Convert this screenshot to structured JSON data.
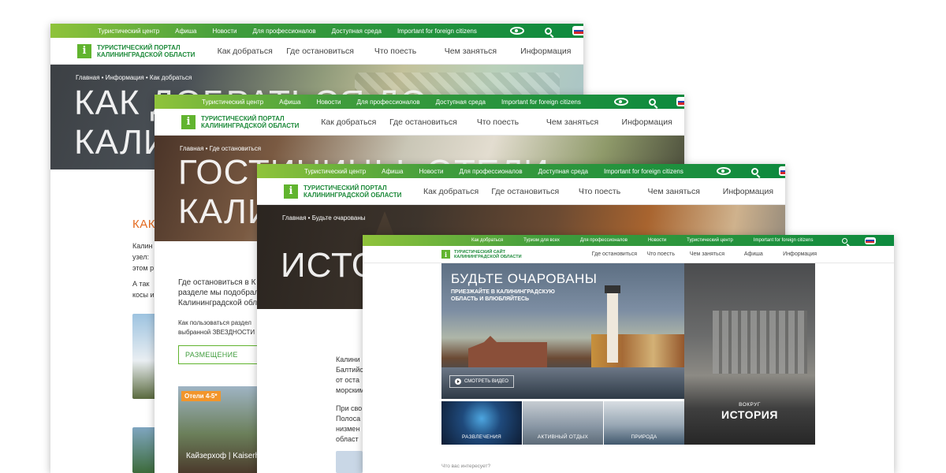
{
  "top_links": {
    "w1": [
      "Туристический центр",
      "Афиша",
      "Новости",
      "Для профессионалов",
      "Доступная среда",
      "Important for foreign citizens"
    ],
    "w4": [
      "Как добраться",
      "Туризм для всех",
      "Для профессионалов",
      "Новости",
      "Туристический центр",
      "Important for foreign citizens"
    ]
  },
  "logo_portal": "ТУРИСТИЧЕСКИЙ ПОРТАЛ\nКАЛИНИНГРАДСКОЙ ОБЛАСТИ",
  "logo_site": "ТУРИСТИЧЕСКИЙ САЙТ\nКАЛИНИНГРАДСКОЙ ОБЛАСТИ",
  "logo_glyph": "i",
  "main_nav": [
    "Как добраться",
    "Где остановиться",
    "Что поесть",
    "Чем заняться",
    "Информация"
  ],
  "main_nav_w4": [
    "Где остановиться",
    "Что поесть",
    "Чем заняться",
    "Афиша",
    "Информация"
  ],
  "icons": {
    "accessibility": "eye-icon",
    "search": "search-icon",
    "language": "flag-ru-icon"
  },
  "colors": {
    "green": "#0d8a3e",
    "lime": "#8fc33b",
    "orange": "#e46a1f"
  },
  "window1": {
    "breadcrumb": "Главная  •  Информация  •  Как добраться",
    "title_line1": "КАК ДОБРАТЬСЯ ДО",
    "title_line2": "КАЛИНИНГРАДА",
    "section_title": "КАК",
    "text1": "Калин",
    "text2": "узел: ",
    "text3": "этом р",
    "text4": "А так",
    "text5": "косы и"
  },
  "window2": {
    "breadcrumb": "Главная  •  Где остановиться",
    "title_line1": "ГОСТИНИЦЫ, ОТЕЛИ",
    "title_line2": "КАЛИНИНГРАДА",
    "intro1": "Где остановиться в К",
    "intro2": "разделе мы подобрал",
    "intro3": "Калининградской обл",
    "small1": "Как пользоваться раздел",
    "small2": "выбранной ЗВЕЗДНОСТИ",
    "filter_label": "РАЗМЕЩЕНИЕ",
    "card_badge": "Отели 4-5*",
    "card_caption": "Кайзерхоф | Kaiserho"
  },
  "window3": {
    "breadcrumb": "Главная  •  Будьте очарованы",
    "title": "ИСТОРИЯ",
    "p1": "Калини",
    "p2": "Балтийс",
    "p3": "от  оста",
    "p4": "морским",
    "p5": "При сво",
    "p6": "Полоса",
    "p7": "низмен",
    "p8": "област"
  },
  "window4": {
    "feature_title": "БУДЬТЕ ОЧАРОВАНЫ",
    "feature_sub": "ПРИЕЗЖАЙТЕ В КАЛИНИНГРАДСКУЮ\nОБЛАСТЬ И ВЛЮБЛЯЙТЕСЬ",
    "video_label": "СМОТРЕТЬ ВИДЕО",
    "side_pre": "ВОКРУГ",
    "side_title": "ИСТОРИЯ",
    "tiles": [
      "РАЗВЛЕЧЕНИЯ",
      "АКТИВНЫЙ ОТДЫХ",
      "ПРИРОДА"
    ],
    "interest_prompt": "Что вас интересует?"
  }
}
